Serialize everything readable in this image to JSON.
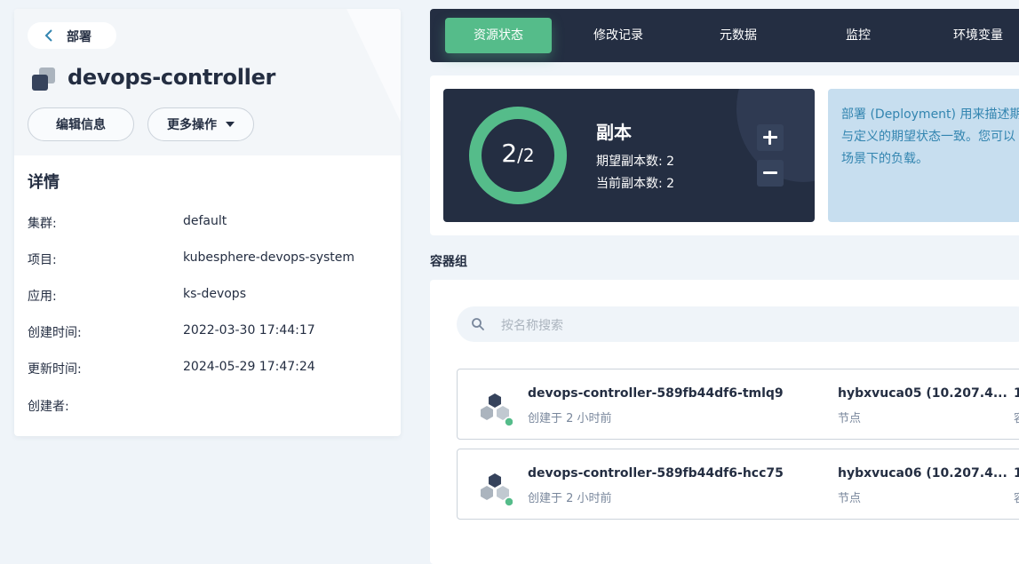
{
  "header": {
    "back_label": "部署",
    "title": "devops-controller",
    "edit_button": "编辑信息",
    "more_button": "更多操作"
  },
  "details": {
    "title": "详情",
    "rows": [
      {
        "key": "集群:",
        "value": "default"
      },
      {
        "key": "项目:",
        "value": "kubesphere-devops-system"
      },
      {
        "key": "应用:",
        "value": "ks-devops"
      },
      {
        "key": "创建时间:",
        "value": "2022-03-30 17:44:17"
      },
      {
        "key": "更新时间:",
        "value": "2024-05-29 17:47:24"
      },
      {
        "key": "创建者:",
        "value": ""
      }
    ]
  },
  "tabs": [
    {
      "label": "资源状态",
      "active": true
    },
    {
      "label": "修改记录",
      "active": false
    },
    {
      "label": "元数据",
      "active": false
    },
    {
      "label": "监控",
      "active": false
    },
    {
      "label": "环境变量",
      "active": false
    }
  ],
  "replicas": {
    "current": "2",
    "desired": "2",
    "title": "副本",
    "desired_line": "期望副本数: 2",
    "current_line": "当前副本数: 2",
    "ratio": 1.0
  },
  "info": {
    "line1": "部署 (Deployment) 用来描述期",
    "line2": "与定义的期望状态一致。您可以",
    "line3": "场景下的负载。"
  },
  "pods": {
    "section_title": "容器组",
    "search_placeholder": "按名称搜索",
    "items": [
      {
        "name": "devops-controller-589fb44df6-tmlq9",
        "created": "创建于 2 小时前",
        "node": "hybxvuca05  (10.207.4...",
        "node_label": "节点",
        "cut": "1",
        "cut2": "容"
      },
      {
        "name": "devops-controller-589fb44df6-hcc75",
        "created": "创建于 2 小时前",
        "node": "hybxvuca06  (10.207.4...",
        "node_label": "节点",
        "cut": "1",
        "cut2": "容"
      }
    ]
  },
  "colors": {
    "accent": "#55bc8a",
    "dark": "#242e42",
    "info_bg": "#c7deef",
    "info_text": "#3385b0"
  }
}
